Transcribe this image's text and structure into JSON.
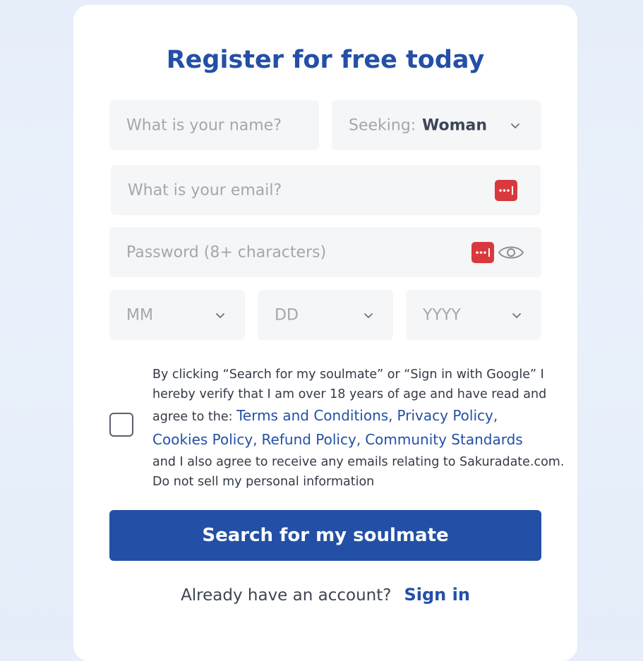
{
  "title": "Register for free today",
  "form": {
    "name_placeholder": "What is your name?",
    "seeking_label": "Seeking:",
    "seeking_value": "Woman",
    "email_placeholder": "What is your email?",
    "password_placeholder": "Password (8+ characters)",
    "month_placeholder": "MM",
    "day_placeholder": "DD",
    "year_placeholder": "YYYY"
  },
  "terms": {
    "line1": "By clicking “Search for my soulmate” or “Sign in with Google” I",
    "line2": "hereby verify that I am over 18 years of age and have read and",
    "line3_prefix": "agree to the:",
    "link_terms": "Terms and Conditions,",
    "link_privacy": "Privacy Policy,",
    "link_cookies": "Cookies Policy,",
    "link_refund": "Refund Policy,",
    "link_community": "Community Standards",
    "line5": "and I also agree to receive any emails relating to Sakuradate.com.",
    "line6": "Do not sell my personal information"
  },
  "submit_label": "Search for my soulmate",
  "footer": {
    "question": "Already have an account?",
    "signin_label": "Sign in"
  },
  "colors": {
    "brand": "#2350a6",
    "field_bg": "#f5f6f8",
    "password_manager_icon": "#d8393c"
  },
  "icons": {
    "select_arrow": "chevron-down-icon",
    "password_manager": "password-manager-icon",
    "show_password": "eye-icon"
  }
}
